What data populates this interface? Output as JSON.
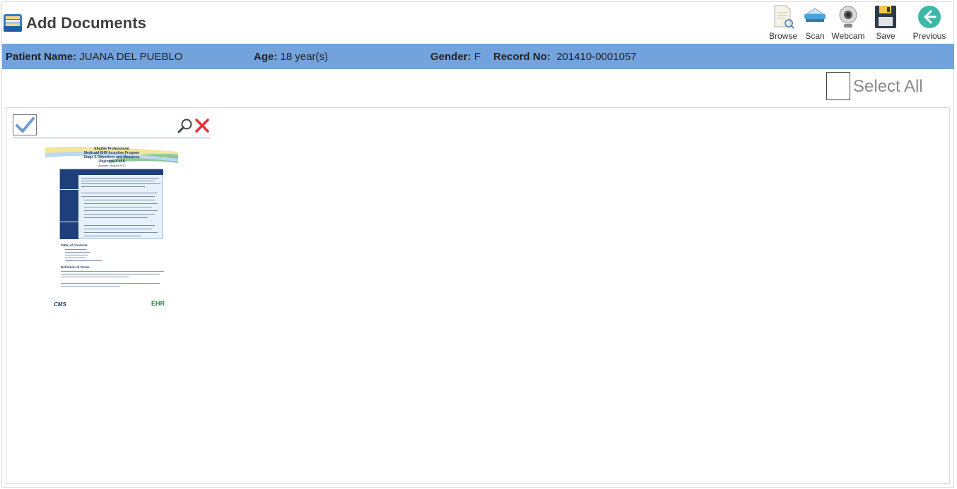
{
  "header": {
    "title": "Add Documents",
    "app_icon": "document-cabinet-icon"
  },
  "toolbar": {
    "browse_label": "Browse",
    "scan_label": "Scan",
    "webcam_label": "Webcam",
    "save_label": "Save",
    "previous_label": "Previous"
  },
  "patient": {
    "name_label": "Patient Name:",
    "name_value": "JUANA DEL PUEBLO",
    "age_label": "Age:",
    "age_value": "18 year(s)",
    "gender_label": "Gender:",
    "gender_value": "F",
    "record_label": "Record No:",
    "record_value": "201410-0001057"
  },
  "select_all": {
    "label": "Select All",
    "checked": false
  },
  "documents": [
    {
      "checked": true,
      "thumbnail": {
        "title_line1": "Eligible Professional",
        "title_line2": "Medicaid EHR Incentive Program",
        "title_line3": "Stage 3 Objectives and Measures",
        "title_line4": "Objective 4 of 8",
        "updated": "Updated: August 2017",
        "toc_heading": "Table of Contents",
        "definition_heading": "Definition of Terms",
        "logo_left": "CMS",
        "logo_right": "EHR"
      }
    }
  ],
  "colors": {
    "patient_bar": "#73a3dc",
    "title_text": "#404040",
    "remove_icon": "#e8303a",
    "previous_icon": "#3db8a8"
  }
}
